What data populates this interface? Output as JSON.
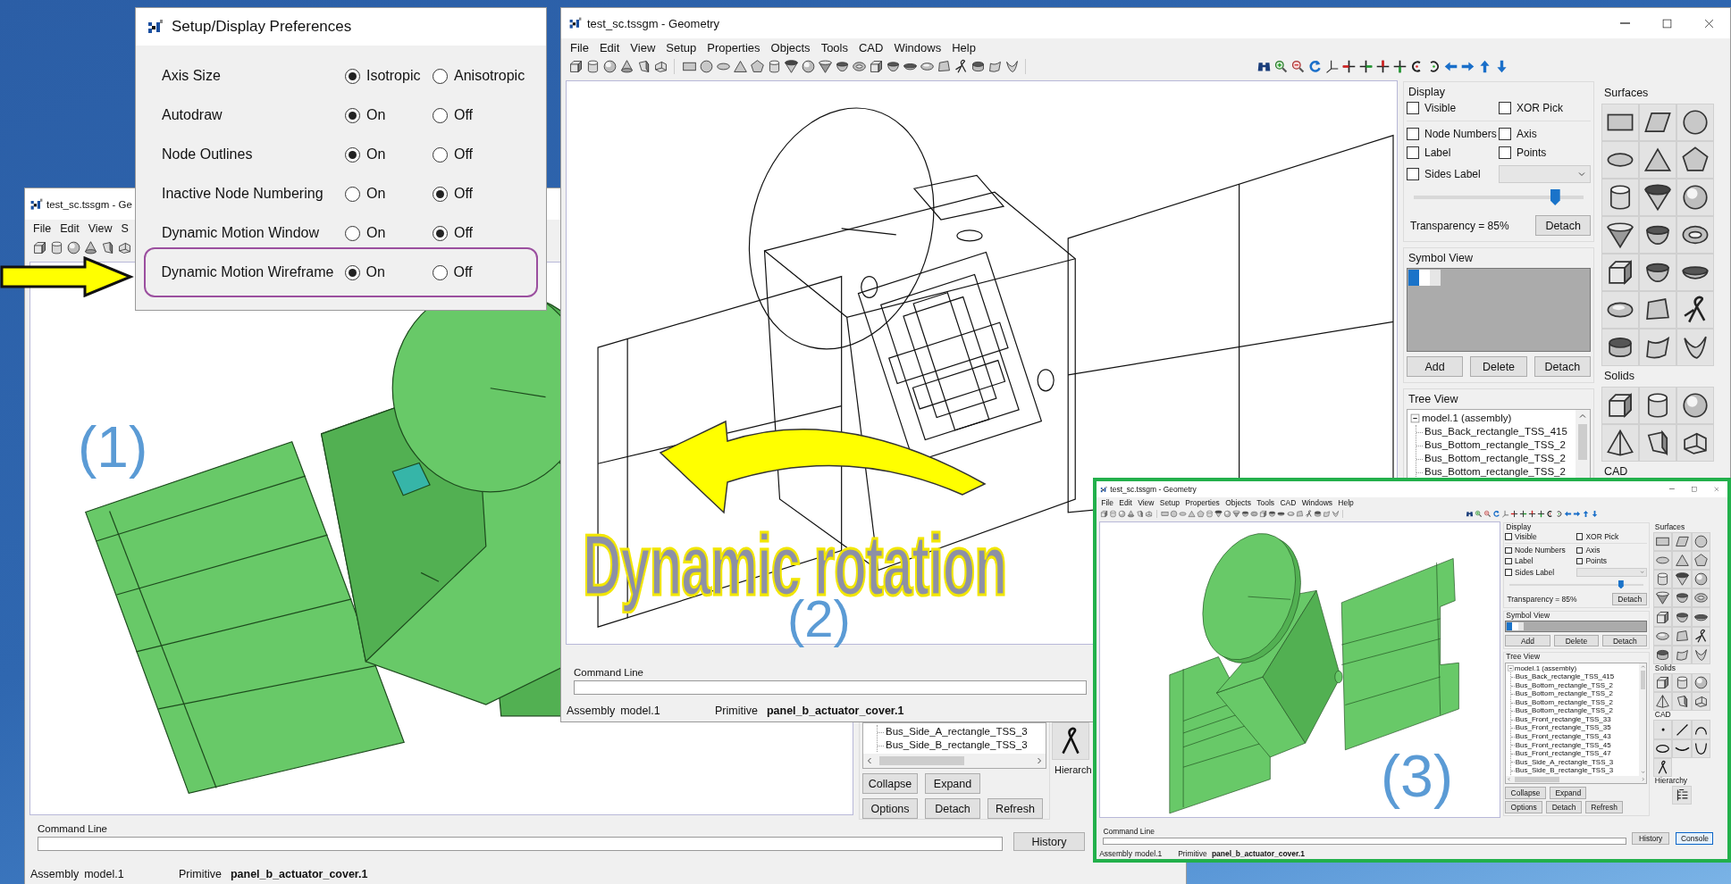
{
  "preferences_dialog": {
    "title": "Setup/Display Preferences",
    "rows": [
      {
        "label": "Axis Size",
        "highlighted": false,
        "options": [
          {
            "label": "Isotropic",
            "selected": true
          },
          {
            "label": "Anisotropic",
            "selected": false
          }
        ]
      },
      {
        "label": "Autodraw",
        "highlighted": false,
        "options": [
          {
            "label": "On",
            "selected": true
          },
          {
            "label": "Off",
            "selected": false
          }
        ]
      },
      {
        "label": "Node Outlines",
        "highlighted": false,
        "options": [
          {
            "label": "On",
            "selected": true
          },
          {
            "label": "Off",
            "selected": false
          }
        ]
      },
      {
        "label": "Inactive Node Numbering",
        "highlighted": false,
        "options": [
          {
            "label": "On",
            "selected": false
          },
          {
            "label": "Off",
            "selected": true
          }
        ]
      },
      {
        "label": "Dynamic Motion Window",
        "highlighted": false,
        "options": [
          {
            "label": "On",
            "selected": false
          },
          {
            "label": "Off",
            "selected": true
          }
        ]
      },
      {
        "label": "Dynamic Motion Wireframe",
        "highlighted": true,
        "options": [
          {
            "label": "On",
            "selected": true
          },
          {
            "label": "Off",
            "selected": false
          }
        ]
      }
    ]
  },
  "left_window": {
    "title": "test_sc.tssgm - Ge",
    "menu": [
      "File",
      "Edit",
      "View",
      "S"
    ],
    "wireframe": false,
    "callout": "(1)",
    "tree": {
      "items": [
        {
          "children": [
            {
              "label": "Bus_Side_A_rectangle_TSS_3"
            },
            {
              "label": "Bus_Side_B_rectangle_TSS_3"
            }
          ]
        }
      ],
      "buttons": [
        [
          "Collapse",
          "Expand"
        ],
        [
          "Options",
          "Detach",
          "Refresh"
        ]
      ]
    },
    "hierarchy_label": "Hierarch",
    "command_line": {
      "label": "Command Line"
    },
    "buttons": [
      {
        "label": "History",
        "focused": false
      }
    ],
    "status": {
      "assembly_label": "Assembly",
      "assembly": "model.1",
      "primitive_label": "Primitive",
      "primitive": "panel_b_actuator_cover.1"
    }
  },
  "geometry_window": {
    "title": "test_sc.tssgm - Geometry",
    "menu": [
      "File",
      "Edit",
      "View",
      "Setup",
      "Properties",
      "Objects",
      "Tools",
      "CAD",
      "Windows",
      "Help"
    ],
    "wireframe": true,
    "caption": "Dynamic rotation",
    "callout": "(2)",
    "display": {
      "title": "Display",
      "checks": [
        {
          "label": "Visible",
          "checked": false
        },
        {
          "label": "XOR Pick",
          "checked": false
        },
        {
          "label": "Node Numbers",
          "checked": false
        },
        {
          "label": "Axis",
          "checked": false
        },
        {
          "label": "Label",
          "checked": false
        },
        {
          "label": "Points",
          "checked": false
        },
        {
          "label": "Sides Label",
          "checked": false
        }
      ],
      "transparency": {
        "level": 0.83,
        "reading": "Transparency = 85%"
      },
      "button": "Detach"
    },
    "symbol_view": {
      "title": "Symbol View",
      "buttons": [
        "Add",
        "Delete",
        "Detach"
      ]
    },
    "tree": {
      "title": "Tree View",
      "items": [
        {
          "label": "model.1 (assembly)",
          "expanded": true,
          "children": [
            {
              "label": "Bus_Back_rectangle_TSS_415"
            },
            {
              "label": "Bus_Bottom_rectangle_TSS_2"
            },
            {
              "label": "Bus_Bottom_rectangle_TSS_2"
            },
            {
              "label": "Bus_Bottom_rectangle_TSS_2"
            }
          ]
        }
      ]
    },
    "palettes": [
      {
        "kind": "surfaces",
        "title": "Surfaces"
      },
      {
        "kind": "solids",
        "title": "Solids"
      },
      {
        "kind": "heading",
        "title": "CAD"
      }
    ],
    "command_line": {
      "label": "Command Line"
    },
    "status": {
      "assembly_label": "Assembly",
      "assembly": "model.1",
      "primitive_label": "Primitive",
      "primitive": "panel_b_actuator_cover.1"
    }
  },
  "inset_window": {
    "title": "test_sc.tssgm - Geometry",
    "menu": [
      "File",
      "Edit",
      "View",
      "Setup",
      "Properties",
      "Objects",
      "Tools",
      "CAD",
      "Windows",
      "Help"
    ],
    "wireframe": false,
    "callout": "(3)",
    "display": {
      "title": "Display",
      "checks": [
        {
          "label": "Visible",
          "checked": false
        },
        {
          "label": "XOR Pick",
          "checked": false
        },
        {
          "label": "Node Numbers",
          "checked": false
        },
        {
          "label": "Axis",
          "checked": false
        },
        {
          "label": "Label",
          "checked": false
        },
        {
          "label": "Points",
          "checked": false
        },
        {
          "label": "Sides Label",
          "checked": false
        }
      ],
      "transparency": {
        "level": 0.83,
        "reading": "Transparency = 85%"
      },
      "button": "Detach"
    },
    "symbol_view": {
      "title": "Symbol View",
      "buttons": [
        "Add",
        "Delete",
        "Detach"
      ]
    },
    "tree": {
      "title": "Tree View",
      "items": [
        {
          "label": "model.1 (assembly)",
          "expanded": true,
          "children": [
            {
              "label": "Bus_Back_rectangle_TSS_415"
            },
            {
              "label": "Bus_Bottom_rectangle_TSS_2"
            },
            {
              "label": "Bus_Bottom_rectangle_TSS_2"
            },
            {
              "label": "Bus_Bottom_rectangle_TSS_2"
            },
            {
              "label": "Bus_Bottom_rectangle_TSS_2"
            },
            {
              "label": "Bus_Front_rectangle_TSS_33"
            },
            {
              "label": "Bus_Front_rectangle_TSS_35"
            },
            {
              "label": "Bus_Front_rectangle_TSS_43"
            },
            {
              "label": "Bus_Front_rectangle_TSS_45"
            },
            {
              "label": "Bus_Front_rectangle_TSS_47"
            },
            {
              "label": "Bus_Side_A_rectangle_TSS_3"
            },
            {
              "label": "Bus_Side_B_rectangle_TSS_3"
            }
          ]
        }
      ],
      "buttons": [
        [
          "Collapse",
          "Expand"
        ],
        [
          "Options",
          "Detach",
          "Refresh"
        ]
      ]
    },
    "palettes": [
      {
        "kind": "surfaces",
        "title": "Surfaces"
      },
      {
        "kind": "solids",
        "title": "Solids"
      },
      {
        "kind": "cad",
        "title": "CAD"
      },
      {
        "kind": "hierarchy",
        "title": "Hierarchy"
      }
    ],
    "command_line": {
      "label": "Command Line"
    },
    "buttons": [
      {
        "label": "History",
        "focused": false
      },
      {
        "label": "Console",
        "focused": true
      }
    ],
    "status": {
      "assembly_label": "Assembly",
      "assembly": "model.1",
      "primitive_label": "Primitive",
      "primitive": "panel_b_actuator_cover.1"
    }
  }
}
